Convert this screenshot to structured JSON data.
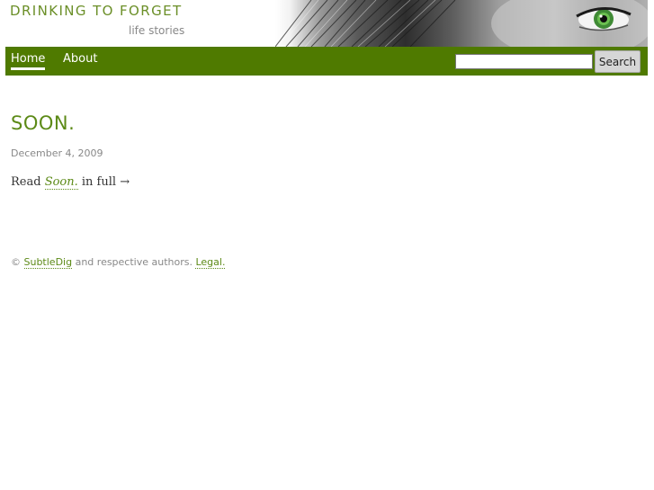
{
  "site": {
    "title": "DRINKING TO FORGET",
    "tagline": "life stories"
  },
  "nav": {
    "items": [
      {
        "label": "Home",
        "active": true
      },
      {
        "label": "About",
        "active": false
      }
    ],
    "search": {
      "input_value": "",
      "button_label": "Search"
    }
  },
  "post": {
    "title": "SOON.",
    "date": "December 4, 2009",
    "read_prefix": "Read ",
    "read_link": "Soon.",
    "read_suffix": " in full →"
  },
  "footer": {
    "copyright_symbol": "© ",
    "link1": "SubtleDig",
    "middle_text": " and respective authors. ",
    "link2": "Legal."
  },
  "colors": {
    "accent": "#5c8a17",
    "navbar": "#4f7a00",
    "muted_text": "#888888"
  }
}
